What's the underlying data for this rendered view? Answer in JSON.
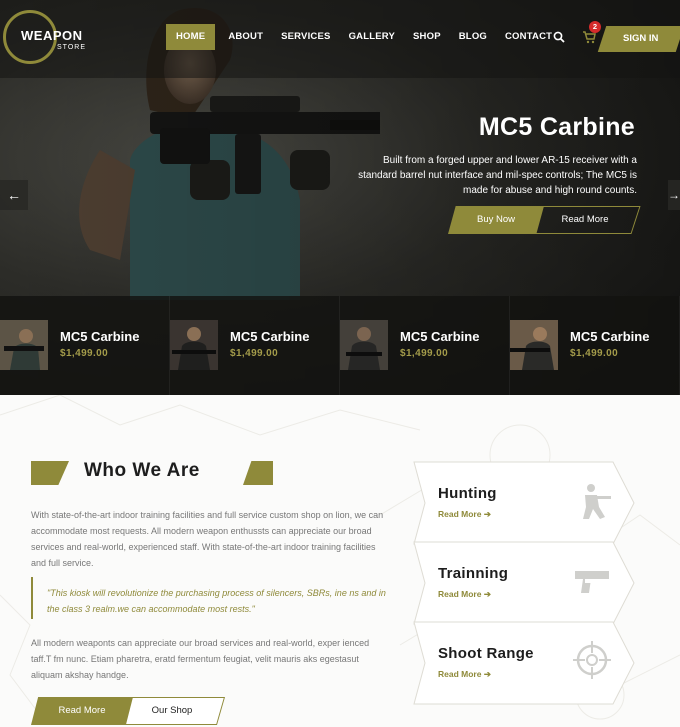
{
  "brand": {
    "logo_word": "WEAPON",
    "logo_sub": "STORE"
  },
  "nav": {
    "items": [
      "HOME",
      "ABOUT",
      "SERVICES",
      "GALLERY",
      "SHOP",
      "BLOG",
      "CONTACT"
    ],
    "active": "HOME",
    "cart_count": "2",
    "signin_label": "SIGN IN"
  },
  "hero": {
    "title": "MC5 Carbine",
    "description": "Built from a forged upper and lower AR-15 receiver with a standard barrel nut interface and mil-spec controls; The MC5 is made for abuse and high round counts.",
    "buy_label": "Buy Now",
    "read_label": "Read More",
    "prev_arrow": "←",
    "next_arrow": "→"
  },
  "products": [
    {
      "name": "MC5 Carbine",
      "price": "$1,499.00"
    },
    {
      "name": "MC5 Carbine",
      "price": "$1,499.00"
    },
    {
      "name": "MC5 Carbine",
      "price": "$1,499.00"
    },
    {
      "name": "MC5 Carbine",
      "price": "$1,499.00"
    }
  ],
  "about": {
    "title": "Who We Are",
    "paragraph1": "With state-of-the-art indoor training facilities and full service custom shop on lion, we can accommodate most requests. All modern weapon enthussts can appreciate our broad services and real-world, experienced staff. With state-of-the-art indoor training facilities and full service.",
    "quote": "\"This kiosk will revolutionize the purchasing process of silencers, SBRs, ine ns and in the class 3 realm.we can accommodate most rests.\"",
    "paragraph2": "All modern weaponts can appreciate our broad services and real-world, exper ienced taff.T fm nunc. Etiam pharetra, eratd fermentum feugiat, velit mauris aks egestasut aliquam akshay handge.",
    "more_label": "Read More",
    "shop_label": "Our Shop"
  },
  "services": [
    {
      "title": "Hunting",
      "link": "Read More ➔",
      "icon": "hunter-icon"
    },
    {
      "title": "Trainning",
      "link": "Read More ➔",
      "icon": "pistol-icon"
    },
    {
      "title": "Shoot Range",
      "link": "Read More ➔",
      "icon": "crosshair-icon"
    }
  ],
  "colors": {
    "accent": "#8f8a3a",
    "price": "#a49c4a",
    "dark": "#1a1a18",
    "badge": "#d52b2b"
  }
}
